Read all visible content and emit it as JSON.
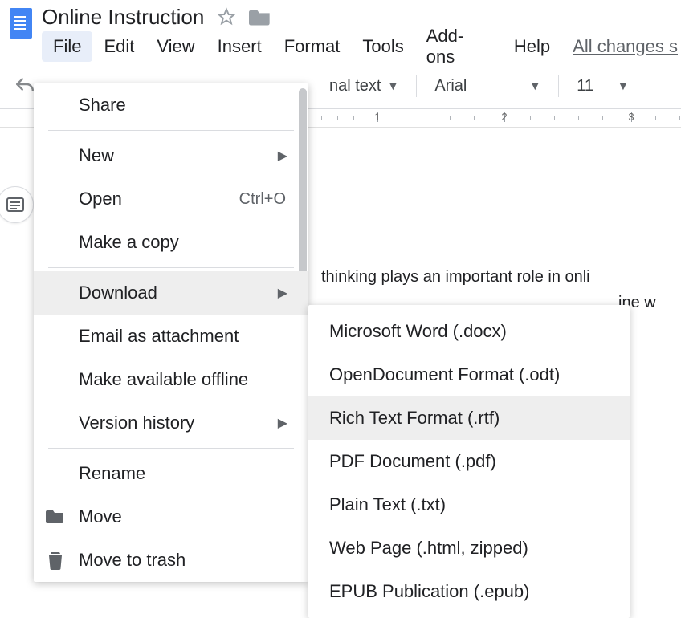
{
  "doc": {
    "title": "Online Instruction",
    "body_line1": "thinking plays an important role in onli",
    "body_line2": "ine w"
  },
  "menubar": {
    "file": "File",
    "edit": "Edit",
    "view": "View",
    "insert": "Insert",
    "format": "Format",
    "tools": "Tools",
    "addons": "Add-ons",
    "help": "Help",
    "all_changes": "All changes s"
  },
  "toolbar": {
    "style_label": "nal text",
    "font_label": "Arial",
    "font_size": "11"
  },
  "ruler": {
    "marks": [
      "1",
      "2",
      "3"
    ]
  },
  "file_menu": {
    "share": "Share",
    "new": "New",
    "open": "Open",
    "open_shortcut": "Ctrl+O",
    "make_copy": "Make a copy",
    "download": "Download",
    "email_attachment": "Email as attachment",
    "available_offline": "Make available offline",
    "version_history": "Version history",
    "rename": "Rename",
    "move": "Move",
    "move_to_trash": "Move to trash"
  },
  "download_submenu": {
    "docx": "Microsoft Word (.docx)",
    "odt": "OpenDocument Format (.odt)",
    "rtf": "Rich Text Format (.rtf)",
    "pdf": "PDF Document (.pdf)",
    "txt": "Plain Text (.txt)",
    "html": "Web Page (.html, zipped)",
    "epub": "EPUB Publication (.epub)"
  }
}
